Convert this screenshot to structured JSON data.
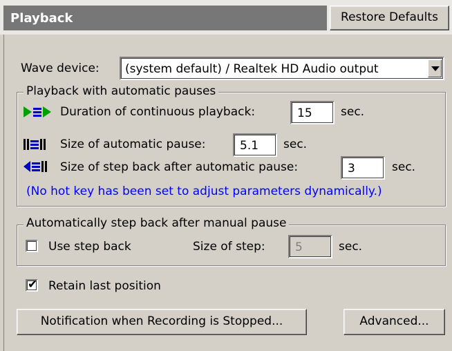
{
  "header": {
    "title": "Playback",
    "restore_label": "Restore Defaults"
  },
  "wave_device": {
    "label": "Wave device:",
    "value": "(system default)  /  Realtek HD Audio output"
  },
  "auto_pause_group": {
    "legend": "Playback with automatic pauses",
    "duration_label": "Duration of continuous playback:",
    "duration_value": "15",
    "duration_unit": "sec.",
    "pause_size_label": "Size of automatic pause:",
    "pause_size_value": "5.1",
    "pause_size_unit": "sec.",
    "step_back_label": "Size of step back after automatic pause:",
    "step_back_value": "3",
    "step_back_unit": "sec.",
    "note": "(No hot key has been set to adjust parameters dynamically.)"
  },
  "manual_group": {
    "legend": "Automatically step back after manual pause",
    "use_step_back_label": "Use step back",
    "use_step_back_checked": false,
    "size_of_step_label": "Size of step:",
    "size_of_step_value": "5",
    "size_of_step_unit": "sec."
  },
  "retain": {
    "label": "Retain last position",
    "checked": true
  },
  "buttons": {
    "notification_label": "Notification when Recording is Stopped...",
    "advanced_label": "Advanced..."
  },
  "colors": {
    "green_icon": "#00a000",
    "blue_icon": "#0000c0",
    "note_text": "#0000ff"
  }
}
